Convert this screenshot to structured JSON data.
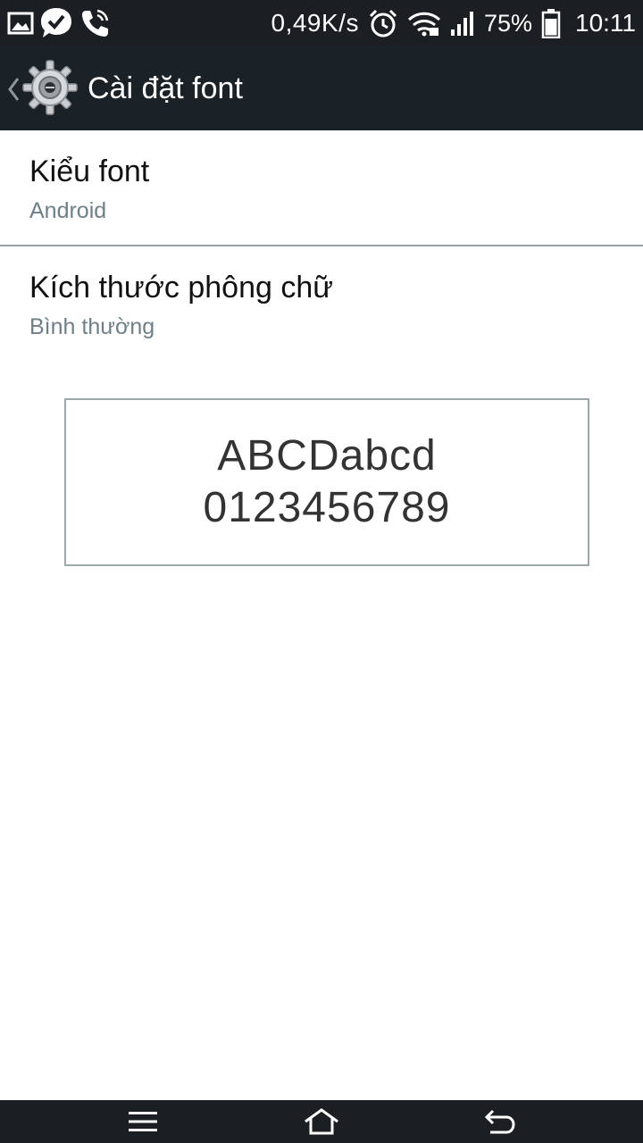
{
  "status_bar": {
    "net_speed": "0,49K/s",
    "battery_percent": "75%",
    "time": "10:11",
    "icons": [
      "image-notification-icon",
      "check-chat-icon",
      "phone-call-icon",
      "alarm-icon",
      "wifi-icon",
      "signal-icon",
      "battery-icon"
    ]
  },
  "action_bar": {
    "title": "Cài đặt font",
    "icon": "gear-icon"
  },
  "settings": [
    {
      "title": "Kiểu font",
      "summary": "Android"
    },
    {
      "title": "Kích thước phông chữ",
      "summary": "Bình thường"
    }
  ],
  "preview": {
    "line1": "ABCDabcd",
    "line2": "0123456789"
  },
  "nav_bar": {
    "icons": [
      "menu-icon",
      "home-icon",
      "back-icon"
    ]
  },
  "colors": {
    "status_bar_bg": "#1b1e22",
    "action_bar_bg": "#1a2127",
    "summary_text": "#6f7f88",
    "divider": "#9aa3a8"
  }
}
